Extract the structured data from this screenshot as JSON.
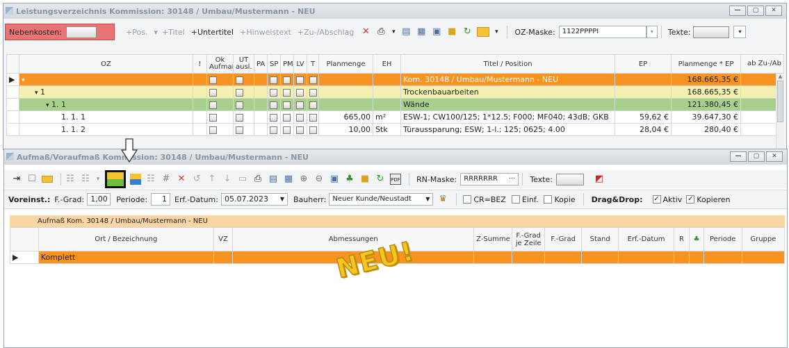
{
  "win1": {
    "title": "Leistungsverzeichnis Kommission: 30148 / Umbau/Mustermann - NEU",
    "toolbar": {
      "nebenkosten": "Nebenkosten:",
      "pos": "+Pos.",
      "titel": "+Titel",
      "untertitel": "+Untertitel",
      "hinweis": "+Hinweistext",
      "zuab": "+Zu-/Abschlag",
      "ozmaske_label": "OZ-Maske:",
      "ozmaske_value": "1122PPPPI",
      "texte_label": "Texte:"
    },
    "columns": [
      "OZ",
      "!",
      "Ok Aufmaß",
      "UT ausl.",
      "PA",
      "SP",
      "PM",
      "LV",
      "T",
      "Planmenge",
      "EH",
      "Titel / Position",
      "EP",
      "Planmenge * EP",
      "ab Zu-/Ab"
    ],
    "rows": [
      {
        "oz": "",
        "menge": "",
        "eh": "",
        "titel": "Kom. 30148 / Umbau/Mustermann - NEU",
        "ep": "",
        "sum": "168.665,35 €"
      },
      {
        "oz": "1",
        "menge": "",
        "eh": "",
        "titel": "Trockenbauarbeiten",
        "ep": "",
        "sum": "168.665,35 €"
      },
      {
        "oz": "1. 1",
        "menge": "",
        "eh": "",
        "titel": "Wände",
        "ep": "",
        "sum": "121.380,45 €"
      },
      {
        "oz": "1. 1.  1",
        "menge": "665,00",
        "eh": "m²",
        "titel": "ESW-1; CW100/125; 1*12.5; F000; MF040; 43dB; GKB",
        "ep": "59,62 €",
        "sum": "39.647,30 €"
      },
      {
        "oz": "1. 1.  2",
        "menge": "10,00",
        "eh": "Stk",
        "titel": "Türaussparung; ESW; 1-l.; 125; 0625; 4.00",
        "ep": "28,04 €",
        "sum": "280,40 €"
      }
    ]
  },
  "win2": {
    "title": "Aufmaß/Voraufmaß Kommission: 30148 / Umbau/Mustermann - NEU",
    "toolbar": {
      "rnmaske_label": "RN-Maske:",
      "rnmaske_value": "RRRRRRR",
      "texte_label": "Texte:"
    },
    "toolbar2": {
      "voreinst": "Voreinst.:",
      "fgrad_label": "F.-Grad:",
      "fgrad_value": "1,00",
      "periode_label": "Periode:",
      "periode_value": "1",
      "erfdatum_label": "Erf.-Datum:",
      "erfdatum_value": "05.07.2023",
      "bauherr_label": "Bauherr:",
      "bauherr_value": "Neuer Kunde/Neustadt",
      "cr_label": "CR=BEZ",
      "einf_label": "Einf.",
      "kopie_label": "Kopie",
      "dragdrop": "Drag&Drop:",
      "aktiv_label": "Aktiv",
      "kopieren_label": "Kopieren"
    },
    "group_header": "Aufmaß Kom. 30148 / Umbau/Mustermann - NEU",
    "columns": [
      "Ort / Bezeichnung",
      "VZ",
      "Abmessungen",
      "Z-Summe",
      "F.-Grad je Zeile",
      "F.-Grad",
      "Stand",
      "Erf.-Datum",
      "R",
      "",
      "Periode",
      "Gruppe"
    ],
    "row": "Komplett",
    "stamp": "NEU!"
  },
  "colors": {
    "orange": "#f7931e",
    "yellow": "#f3f0b0",
    "green": "#a8d08d",
    "peach": "#fbd6a4",
    "red": "#e04040"
  }
}
